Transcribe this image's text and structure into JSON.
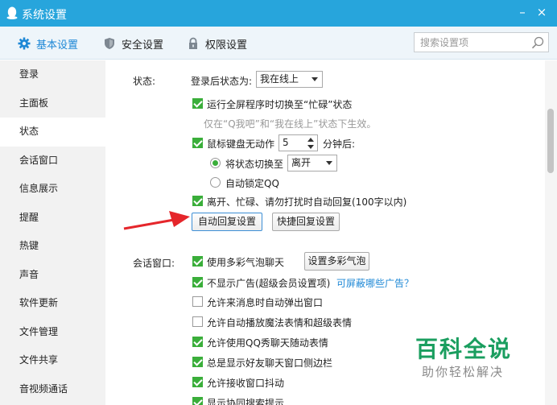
{
  "window": {
    "title": "系统设置",
    "minimize": "–",
    "close": "×"
  },
  "tabs": [
    {
      "label": "基本设置",
      "active": true,
      "icon": "gear-icon"
    },
    {
      "label": "安全设置",
      "active": false,
      "icon": "shield-icon"
    },
    {
      "label": "权限设置",
      "active": false,
      "icon": "lock-icon"
    }
  ],
  "search": {
    "placeholder": "搜索设置项"
  },
  "sidebar": {
    "items": [
      {
        "label": "登录"
      },
      {
        "label": "主面板"
      },
      {
        "label": "状态",
        "active": true
      },
      {
        "label": "会话窗口"
      },
      {
        "label": "信息展示"
      },
      {
        "label": "提醒"
      },
      {
        "label": "热键"
      },
      {
        "label": "声音"
      },
      {
        "label": "软件更新"
      },
      {
        "label": "文件管理"
      },
      {
        "label": "文件共享"
      },
      {
        "label": "音视频通话"
      }
    ]
  },
  "status": {
    "section_label": "状态:",
    "login_status_label": "登录后状态为:",
    "login_status_value": "我在线上",
    "busy_fullscreen": {
      "label": "运行全屏程序时切换至“忙碌”状态",
      "checked": true
    },
    "busy_hint": "仅在“Q我吧”和“我在线上”状态下生效。",
    "idle": {
      "label": "鼠标键盘无动作",
      "checked": true,
      "minutes": "5",
      "unit": "分钟后:"
    },
    "switch_to": {
      "label": "将状态切换至",
      "value": "离开",
      "selected": true
    },
    "auto_lock": {
      "label": "自动锁定QQ",
      "selected": false
    },
    "auto_reply": {
      "label": "离开、忙碌、请勿打扰时自动回复(100字以内)",
      "checked": true
    },
    "auto_reply_button": "自动回复设置",
    "quick_reply_button": "快捷回复设置"
  },
  "chat_window": {
    "section_label": "会话窗口:",
    "options": [
      {
        "label": "使用多彩气泡聊天",
        "checked": true
      },
      {
        "label": "不显示广告(超级会员设置项)",
        "checked": true
      },
      {
        "label": "允许来消息时自动弹出窗口",
        "checked": false
      },
      {
        "label": "允许自动播放魔法表情和超级表情",
        "checked": false
      },
      {
        "label": "允许使用QQ秀聊天随动表情",
        "checked": true
      },
      {
        "label": "总是显示好友聊天窗口侧边栏",
        "checked": true
      },
      {
        "label": "允许接收窗口抖动",
        "checked": true
      },
      {
        "label": "显示协同搜索提示",
        "checked": true
      }
    ],
    "bubble_button": "设置多彩气泡",
    "ad_link": "可屏蔽哪些广告？"
  },
  "watermark": {
    "title": "百科全说",
    "subtitle": "助你轻松解决"
  },
  "colors": {
    "titlebar": "#27a5dc",
    "accent": "#1e88d6",
    "check": "#3aae3a",
    "arrow": "#e5262b",
    "watermark": "#1a9e5f"
  }
}
